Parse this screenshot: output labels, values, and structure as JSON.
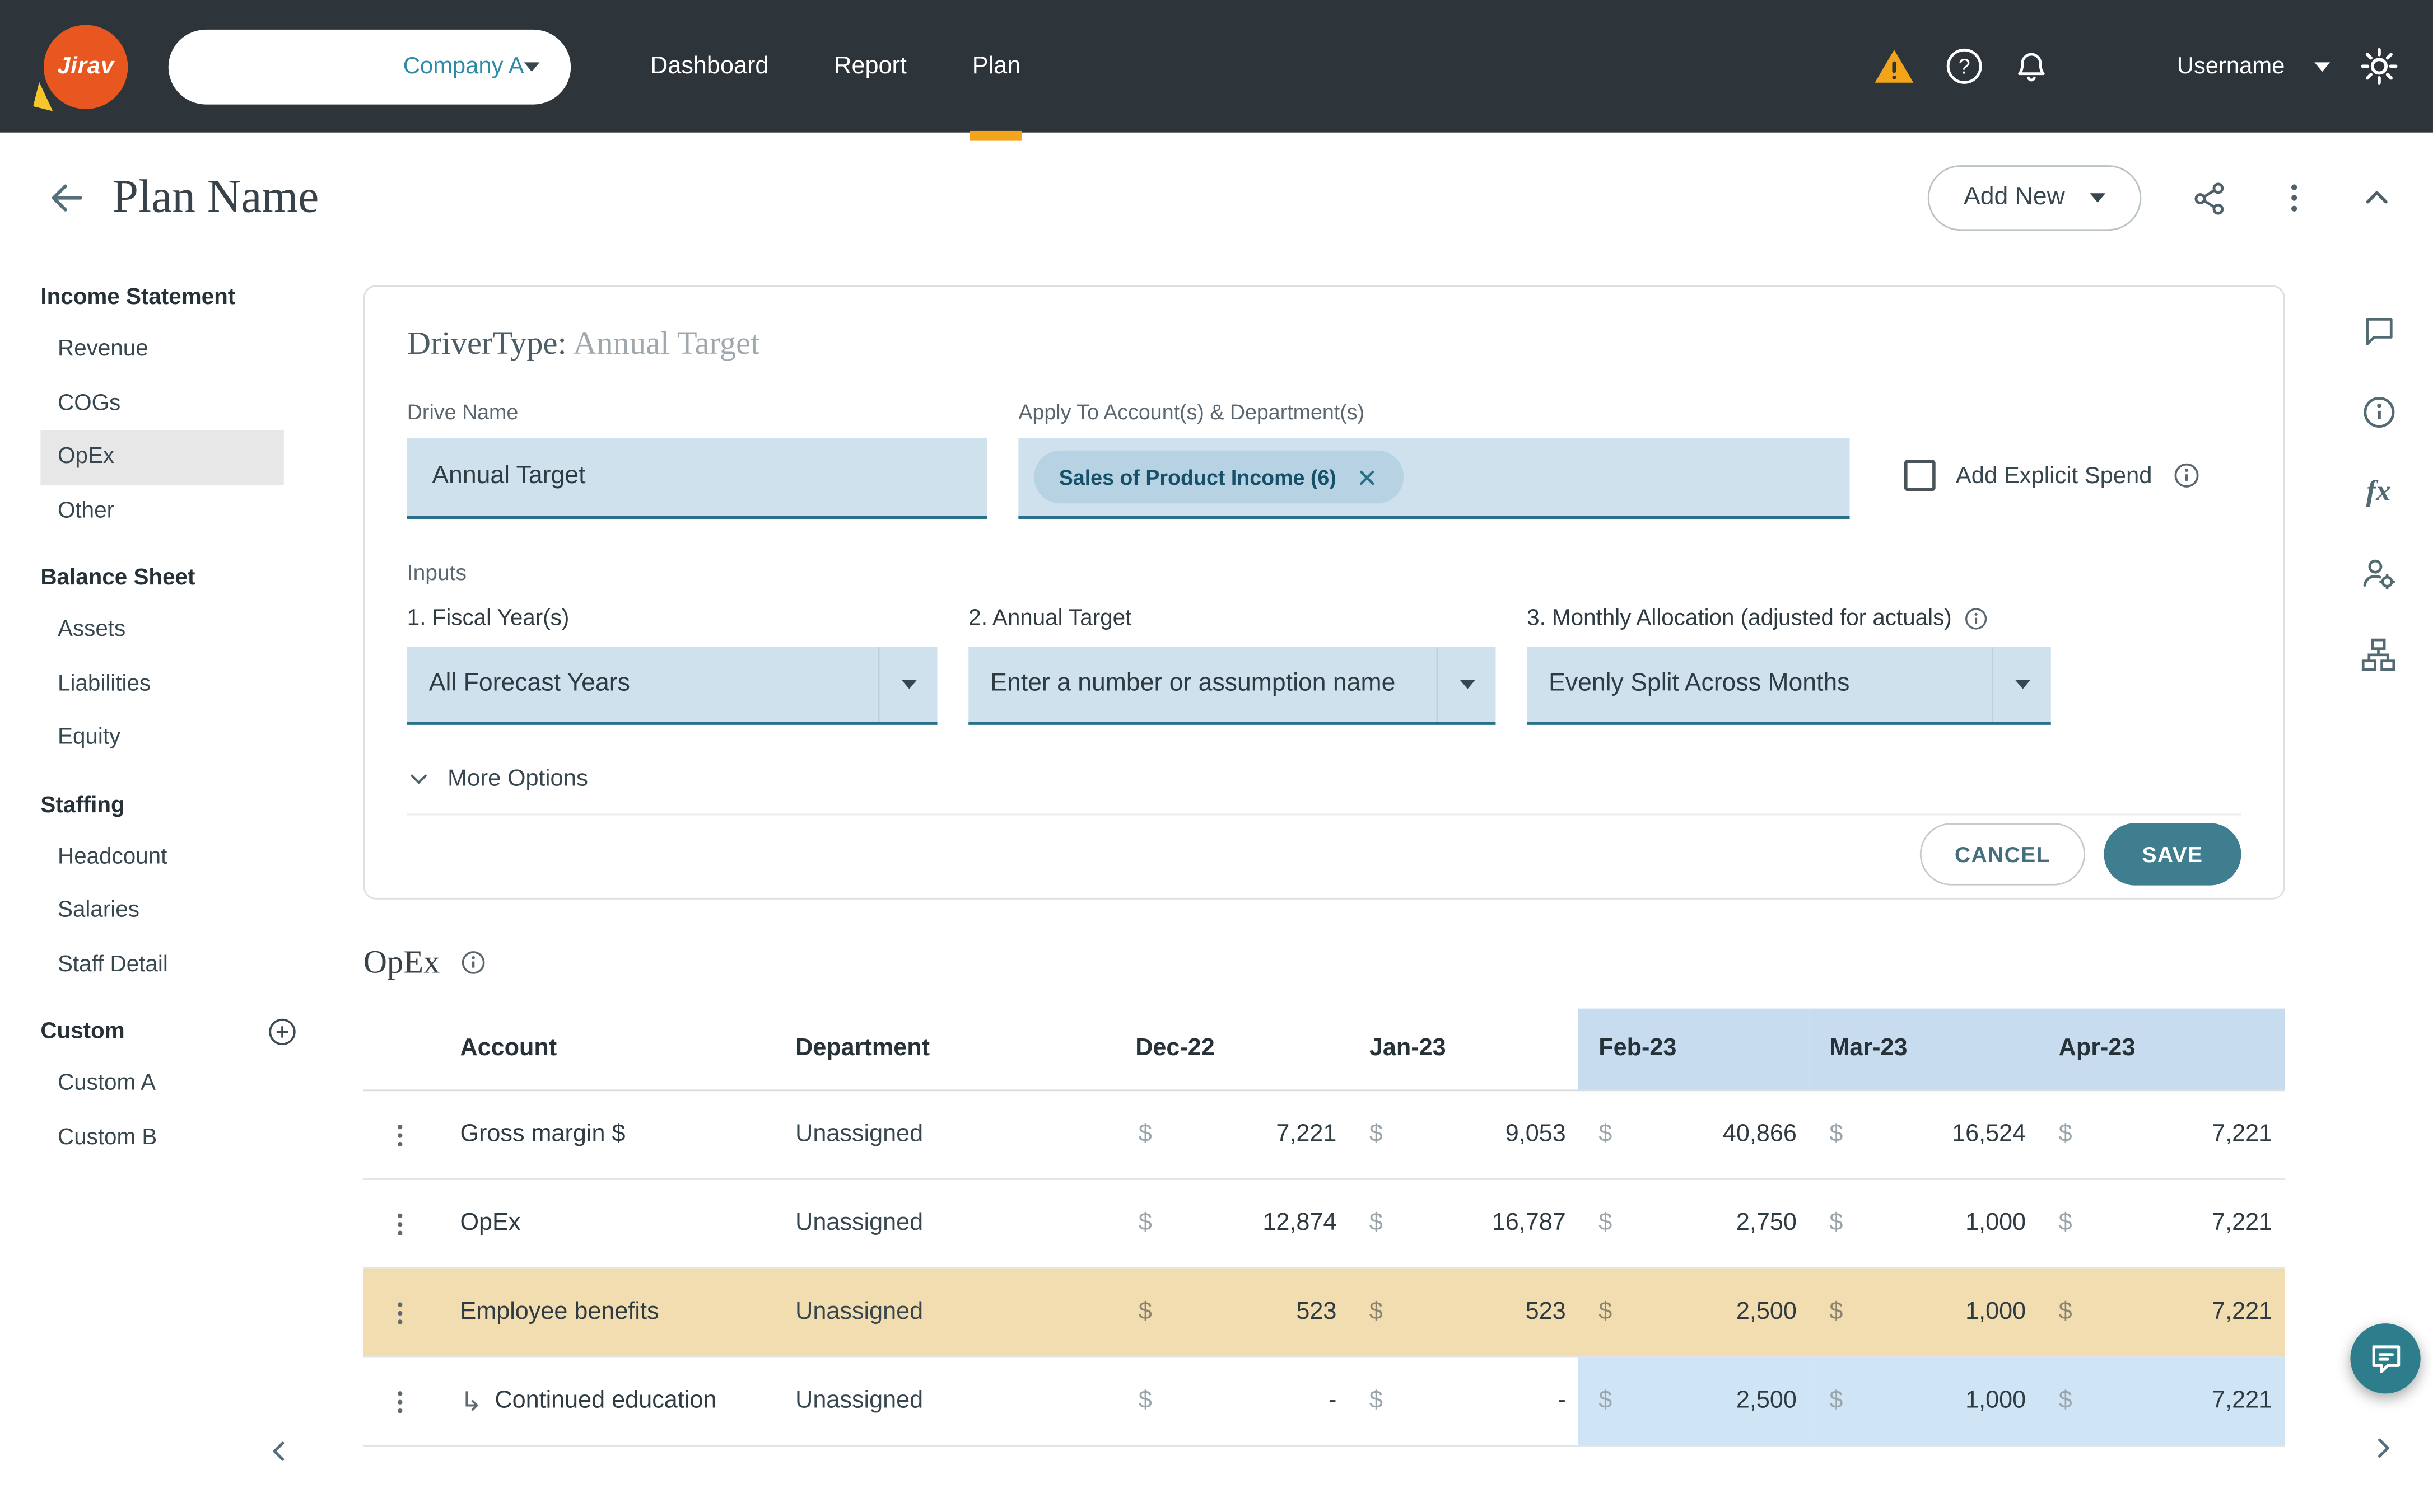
{
  "navbar": {
    "logo_text": "Jirav",
    "company_selector": {
      "value": "Company A"
    },
    "items": [
      {
        "label": "Dashboard"
      },
      {
        "label": "Report"
      },
      {
        "label": "Plan"
      }
    ],
    "active_item": "Plan",
    "username": "Username"
  },
  "header": {
    "title": "Plan Name",
    "add_new_label": "Add New"
  },
  "sidebar": {
    "sections": [
      {
        "title": "Income Statement",
        "items": [
          {
            "label": "Revenue"
          },
          {
            "label": "COGs"
          },
          {
            "label": "OpEx",
            "selected": true
          },
          {
            "label": "Other"
          }
        ]
      },
      {
        "title": "Balance Sheet",
        "items": [
          {
            "label": "Assets"
          },
          {
            "label": "Liabilities"
          },
          {
            "label": "Equity"
          }
        ]
      },
      {
        "title": "Staffing",
        "items": [
          {
            "label": "Headcount"
          },
          {
            "label": "Salaries"
          },
          {
            "label": "Staff Detail"
          }
        ]
      },
      {
        "title": "Custom",
        "items": [
          {
            "label": "Custom A"
          },
          {
            "label": "Custom B"
          }
        ]
      }
    ],
    "selected_item": "OpEx"
  },
  "form": {
    "title_label": "DriverType:",
    "title_value": "Annual Target",
    "drive_name": {
      "label": "Drive Name",
      "value": "Annual Target"
    },
    "apply_to": {
      "label": "Apply To Account(s) & Department(s)",
      "chip": "Sales of Product Income (6)"
    },
    "add_explicit_spend": {
      "label": "Add Explicit Spend",
      "checked": false
    },
    "inputs_label": "Inputs",
    "fields": [
      {
        "label": "1. Fiscal Year(s)",
        "value": "All Forecast Years"
      },
      {
        "label": "2. Annual Target",
        "value": "Enter a number or assumption name"
      },
      {
        "label": "3. Monthly Allocation (adjusted for actuals)",
        "value": "Evenly Split Across Months"
      }
    ],
    "more_options_label": "More Options",
    "cancel_label": "CANCEL",
    "save_label": "SAVE"
  },
  "opex_section": {
    "title": "OpEx"
  },
  "table": {
    "currency": "$",
    "columns": [
      "Account",
      "Department",
      "Dec-22",
      "Jan-23",
      "Feb-23",
      "Mar-23",
      "Apr-23"
    ],
    "highlighted_columns": [
      "Feb-23",
      "Mar-23",
      "Apr-23"
    ],
    "rows": [
      {
        "account": "Gross margin $",
        "department": "Unassigned",
        "values": [
          "7,221",
          "9,053",
          "40,866",
          "16,524",
          "7,221"
        ]
      },
      {
        "account": "OpEx",
        "department": "Unassigned",
        "values": [
          "12,874",
          "16,787",
          "2,750",
          "1,000",
          "7,221"
        ]
      },
      {
        "account": "Employee benefits",
        "department": "Unassigned",
        "values": [
          "523",
          "523",
          "2,500",
          "1,000",
          "7,221"
        ],
        "highlight": "row"
      },
      {
        "account": "Continued education",
        "department": "Unassigned",
        "values": [
          "-",
          "-",
          "2,500",
          "1,000",
          "7,221"
        ],
        "indented": true,
        "highlight": "forecast-cells"
      }
    ]
  },
  "glyphs": {
    "fx": "fx",
    "kebab": "⋮",
    "indent_arrow": "↳"
  },
  "colors": {
    "navbar_bg": "#2D343A",
    "accent_yellow": "#F2A51A",
    "teal_primary": "#3E7E8F",
    "input_bg": "#CFE1EC",
    "input_border": "#2A7089",
    "chip_bg": "#B7D2E2",
    "chip_text": "#17506B",
    "header_highlight": "#C7DCEF",
    "cell_highlight": "#CFE4F5",
    "row_highlight": "#F2DDB1"
  }
}
